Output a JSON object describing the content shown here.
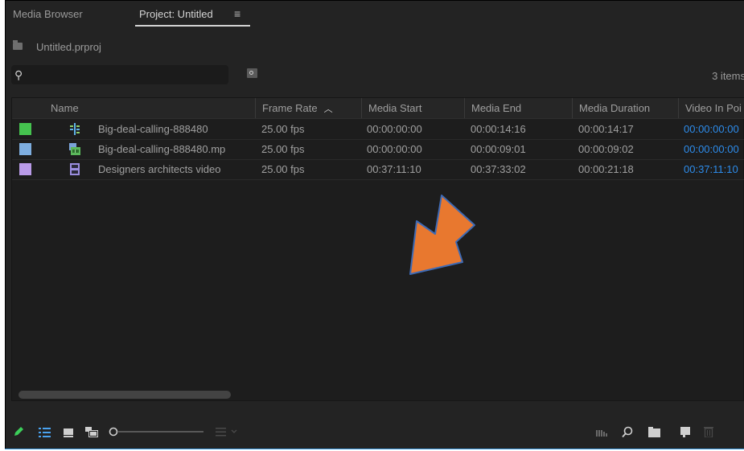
{
  "tabs": [
    {
      "label": "Media Browser"
    },
    {
      "label": "Project: Untitled"
    }
  ],
  "project": {
    "name": "Untitled.prproj"
  },
  "search": {
    "placeholder": "",
    "item_count": "3 items"
  },
  "columns": [
    "Name",
    "Frame Rate",
    "Media Start",
    "Media End",
    "Media Duration",
    "Video In Poi"
  ],
  "rows": [
    {
      "color": "#45c34f",
      "icon": "sequence-icon",
      "name": "Big-deal-calling-888480",
      "frame_rate": "25.00 fps",
      "media_start": "00:00:00:00",
      "media_end": "00:00:14:16",
      "media_duration": "00:00:14:17",
      "video_in": "00:00:00:00"
    },
    {
      "color": "#7eaee0",
      "icon": "multicam-icon",
      "name": "Big-deal-calling-888480.mp",
      "frame_rate": "25.00 fps",
      "media_start": "00:00:00:00",
      "media_end": "00:00:09:01",
      "media_duration": "00:00:09:02",
      "video_in": "00:00:00:00"
    },
    {
      "color": "#b99be8",
      "icon": "film-icon",
      "name": "Designers architects video",
      "frame_rate": "25.00 fps",
      "media_start": "00:37:11:10",
      "media_end": "00:37:33:02",
      "media_duration": "00:00:21:18",
      "video_in": "00:37:11:10"
    }
  ],
  "colors": {
    "accent_blue": "#2d8ceb",
    "annotation_arrow": "#e8782f"
  },
  "footer_icons": [
    "pencil-icon",
    "list-view-icon",
    "icon-view-icon",
    "freeform-view-icon",
    "zoom-slider",
    "sort-icons-icon",
    "automate-to-sequence-icon",
    "find-icon",
    "new-bin-icon",
    "new-item-icon",
    "trash-icon"
  ]
}
